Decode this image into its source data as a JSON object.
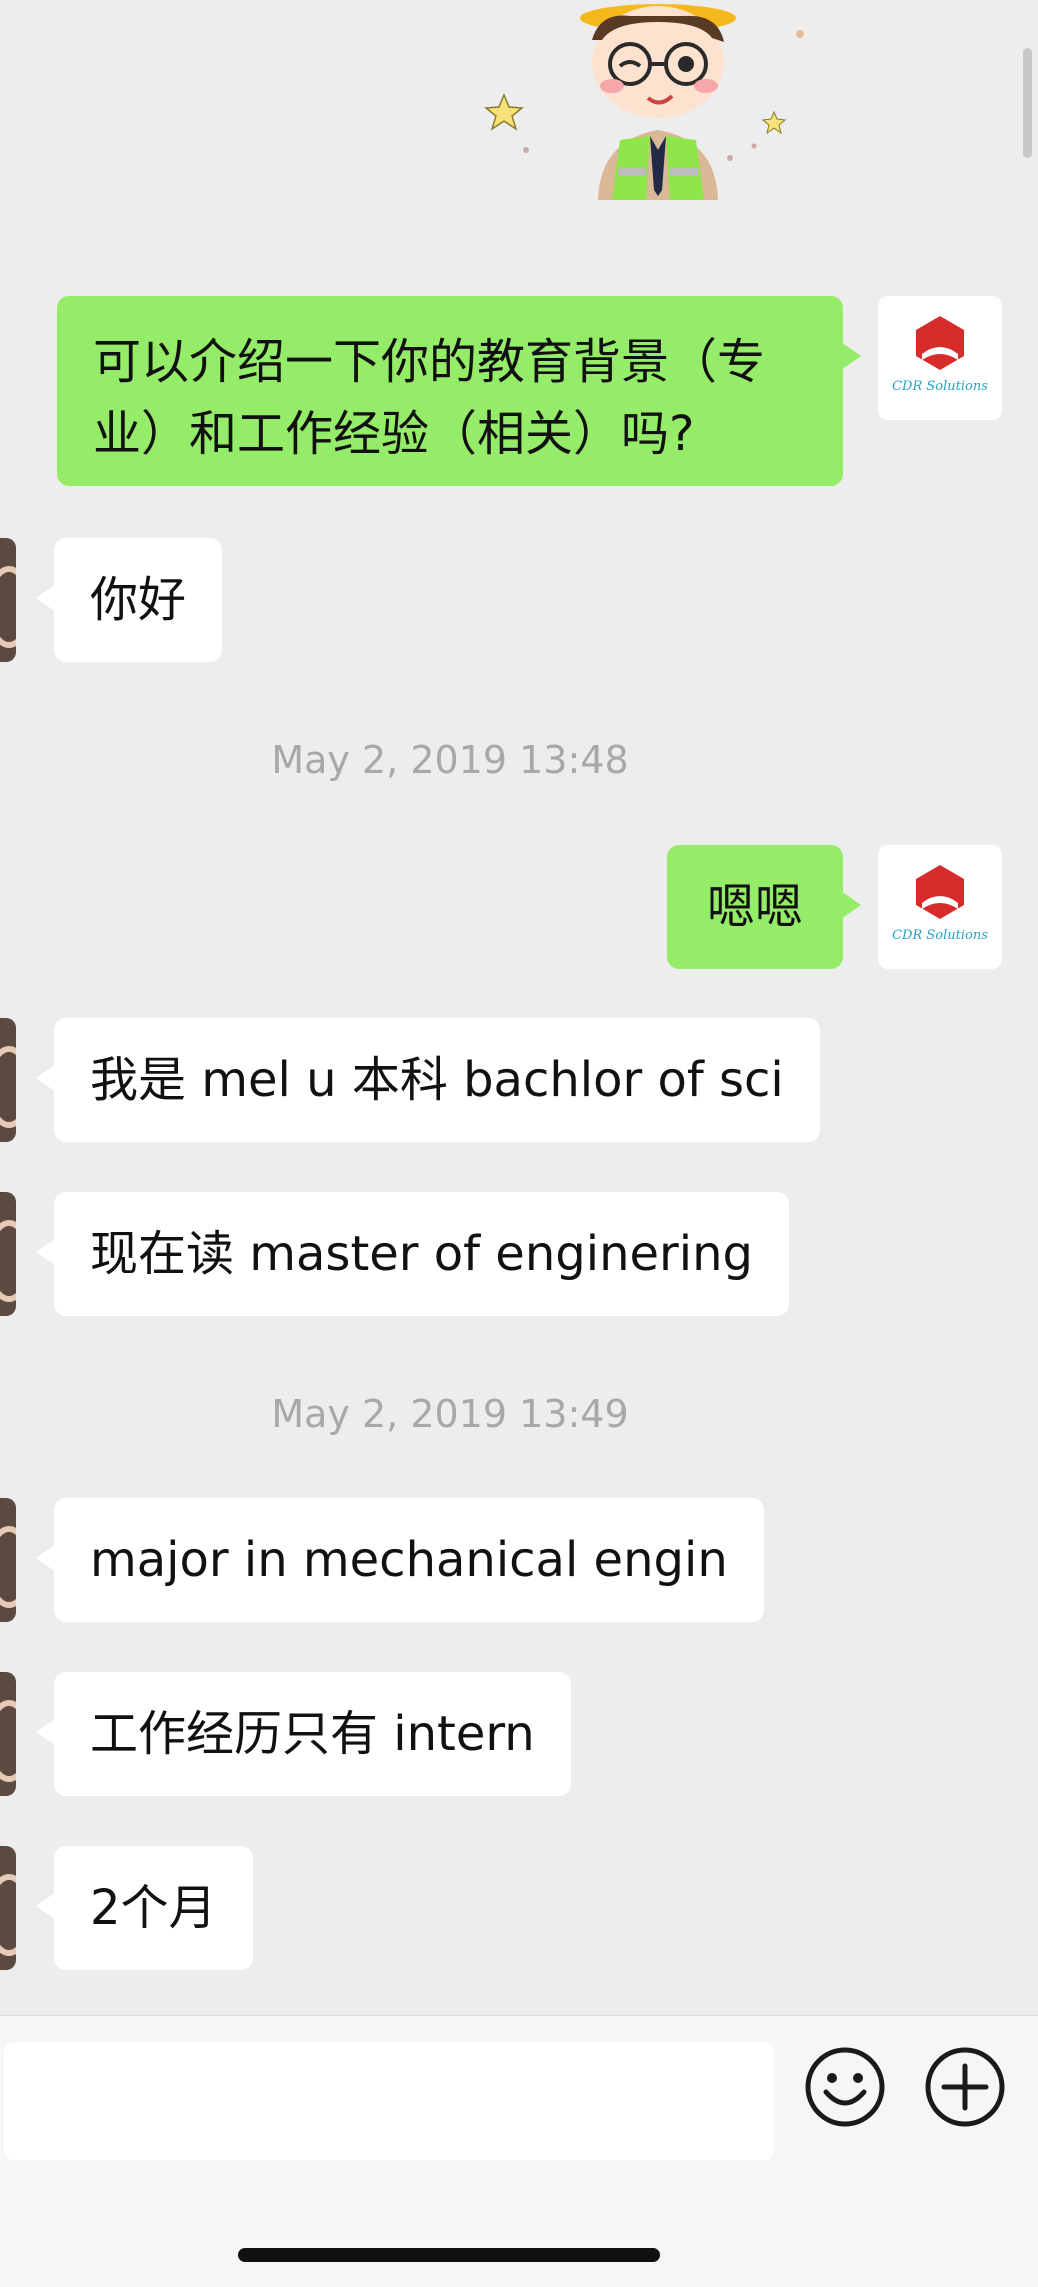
{
  "contact_logo": {
    "brand": "CDR Solutions",
    "color": "#d82c2c"
  },
  "messages": [
    {
      "sender": "me",
      "text_line1": "可以介绍一下你的教育背景（专",
      "text_line2": "业）和工作经验（相关）吗?"
    },
    {
      "sender": "other",
      "text": "你好"
    },
    {
      "type": "timestamp",
      "text": "May 2, 2019 13:48"
    },
    {
      "sender": "me",
      "text": "嗯嗯"
    },
    {
      "sender": "other",
      "text": "我是 mel u 本科 bachlor of sci"
    },
    {
      "sender": "other",
      "text": "现在读 master of enginering"
    },
    {
      "type": "timestamp",
      "text": "May 2, 2019 13:49"
    },
    {
      "sender": "other",
      "text": "major in mechanical engin"
    },
    {
      "sender": "other",
      "text": "工作经历只有 intern"
    },
    {
      "sender": "other",
      "text": "2个月"
    }
  ],
  "input_bar": {
    "placeholder": "",
    "emoji_icon": "smiley-face-icon",
    "more_icon": "plus-circle-icon"
  },
  "colors": {
    "background": "#ededed",
    "my_bubble": "#95ec69",
    "their_bubble": "#ffffff",
    "timestamp": "#a8a8a8"
  }
}
